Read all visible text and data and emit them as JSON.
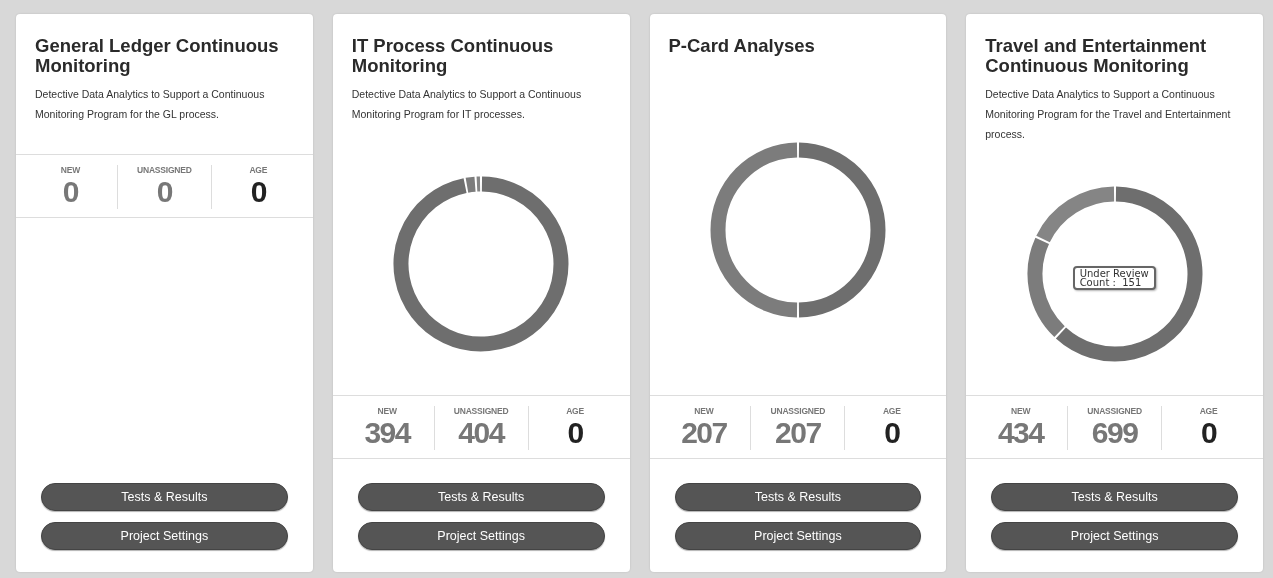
{
  "cards": [
    {
      "title": "General Ledger Continuous Monitoring",
      "description": "Detective Data Analytics to Support a Continuous Monitoring Program for the GL process.",
      "stats": [
        {
          "label": "NEW",
          "value": "0",
          "kind": "muted"
        },
        {
          "label": "UNASSIGNED",
          "value": "0",
          "kind": "muted"
        },
        {
          "label": "AGE",
          "value": "0",
          "kind": "dark"
        }
      ],
      "buttons": [
        "Tests & Results",
        "Project Settings"
      ]
    },
    {
      "title": "IT Process Continuous Monitoring",
      "description": "Detective Data Analytics to Support a Continuous Monitoring Program for IT processes.",
      "chart": {
        "kind": "picture"
      },
      "stats": [
        {
          "label": "NEW",
          "value": "394",
          "kind": "muted"
        },
        {
          "label": "UNASSIGNED",
          "value": "404",
          "kind": "muted"
        },
        {
          "label": "AGE",
          "value": "0",
          "kind": "dark"
        }
      ],
      "buttons": [
        "Tests & Results",
        "Project Settings"
      ]
    },
    {
      "title": "P-Card Analyses",
      "chart": {
        "kind": "picture"
      },
      "stats": [
        {
          "label": "NEW",
          "value": "207",
          "kind": "muted"
        },
        {
          "label": "UNASSIGNED",
          "value": "207",
          "kind": "muted"
        },
        {
          "label": "AGE",
          "value": "0",
          "kind": "dark"
        }
      ],
      "buttons": [
        "Tests & Results",
        "Project Settings"
      ]
    },
    {
      "title": "Travel and Entertainment Continuous Monitoring",
      "description": "Detective Data Analytics to Support a Continuous Monitoring Program for the Travel and Entertainment process.",
      "chart": {
        "kind": "picture",
        "tooltip": [
          "Under Review",
          "Count :  151"
        ]
      },
      "stats": [
        {
          "label": "NEW",
          "value": "434",
          "kind": "muted"
        },
        {
          "label": "UNASSIGNED",
          "value": "699",
          "kind": "muted"
        },
        {
          "label": "AGE",
          "value": "0",
          "kind": "dark"
        }
      ],
      "buttons": [
        "Tests & Results",
        "Project Settings"
      ]
    }
  ]
}
